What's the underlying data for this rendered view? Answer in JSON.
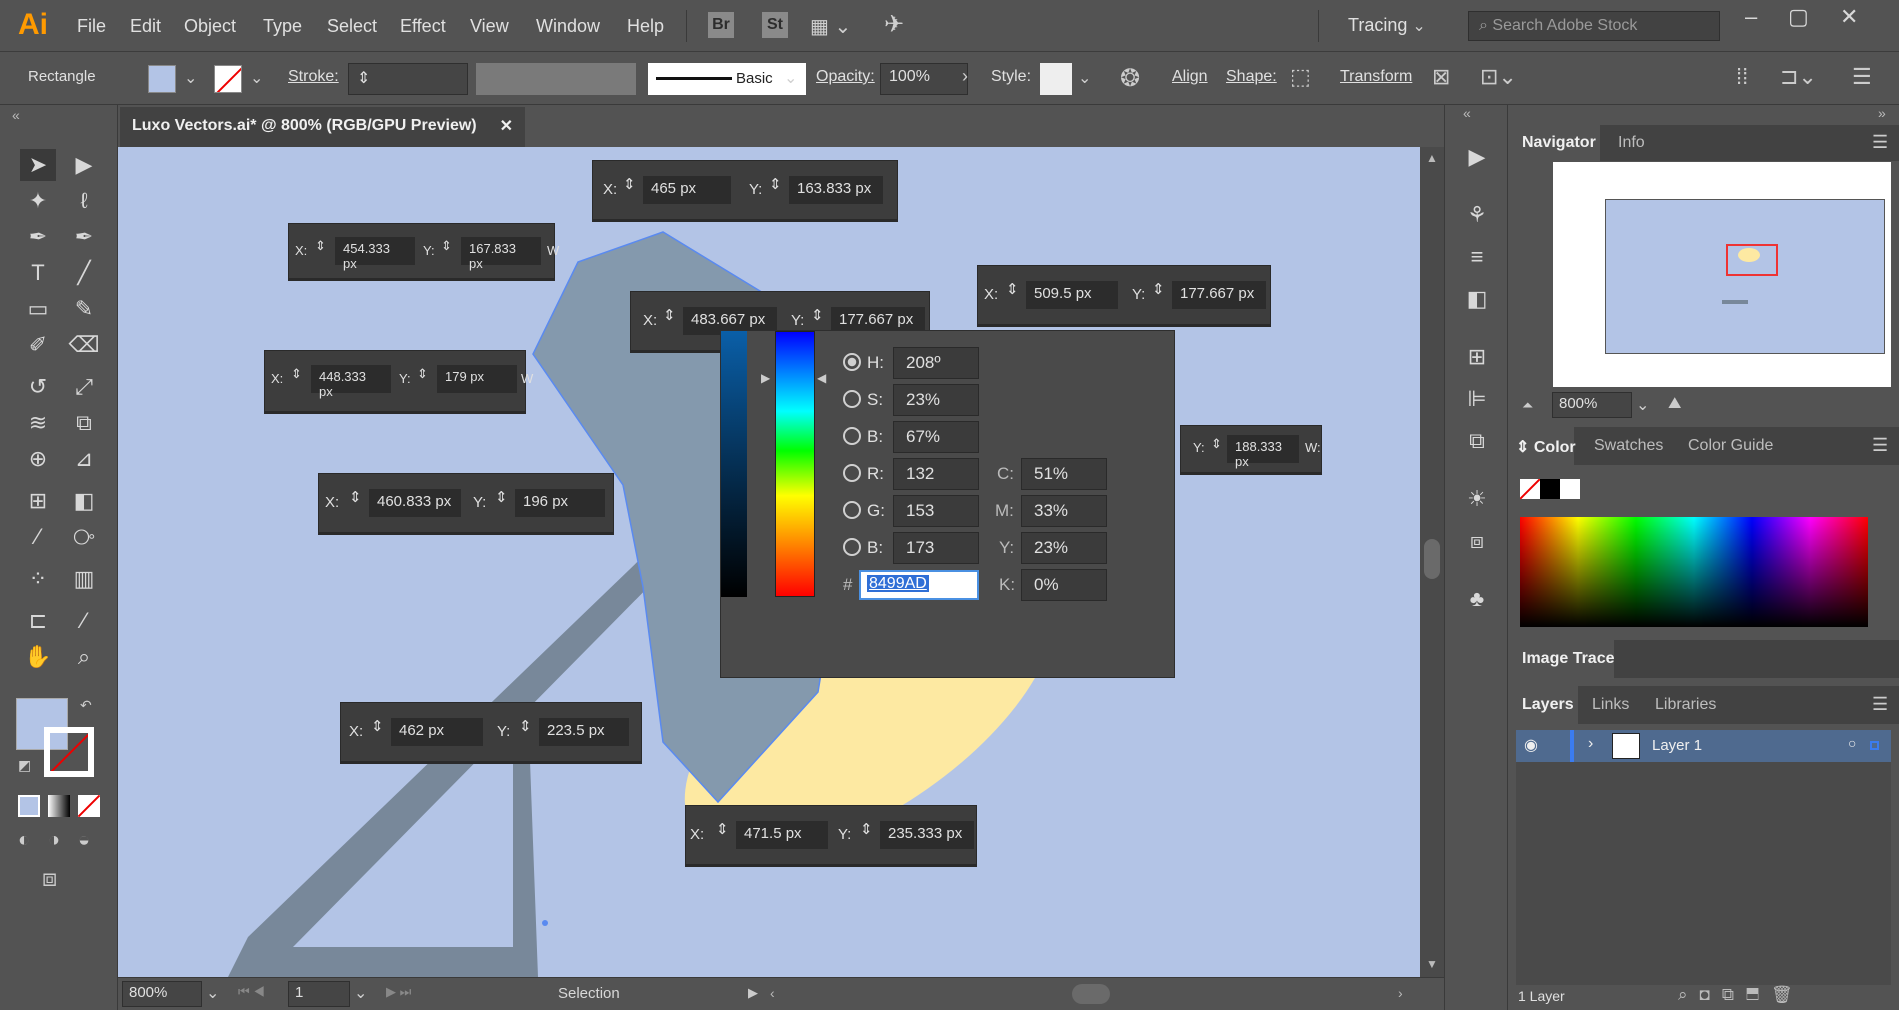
{
  "menubar": {
    "logo": "Ai",
    "items": [
      "File",
      "Edit",
      "Object",
      "Type",
      "Select",
      "Effect",
      "View",
      "Window",
      "Help"
    ],
    "app_br": "Br",
    "app_st": "St",
    "workspace": "Tracing",
    "search_placeholder": "Search Adobe Stock"
  },
  "control": {
    "tool_name": "Rectangle",
    "stroke_label": "Stroke:",
    "brush": "Basic",
    "opacity_label": "Opacity:",
    "opacity_value": "100%",
    "style_label": "Style:",
    "align": "Align",
    "shape": "Shape:",
    "transform": "Transform"
  },
  "document": {
    "tab_title": "Luxo Vectors.ai* @ 800% (RGB/GPU Preview)"
  },
  "coords": [
    {
      "x": "465 px",
      "y": "163.833 px"
    },
    {
      "x": "454.333 px",
      "y": "167.833 px",
      "w": "W"
    },
    {
      "x": "483.667 px",
      "y": "177.667 px"
    },
    {
      "x": "509.5 px",
      "y": "177.667 px"
    },
    {
      "x": "448.333 px",
      "y": "179 px",
      "w": "W"
    },
    {
      "y": "188.333 px",
      "w": "W:"
    },
    {
      "x": "460.833 px",
      "y": "196 px"
    },
    {
      "x": "462 px",
      "y": "223.5 px"
    },
    {
      "x": "471.5 px",
      "y": "235.333 px"
    }
  ],
  "labels": {
    "x": "X:",
    "y": "Y:"
  },
  "picker": {
    "h_label": "H:",
    "h": "208º",
    "s_label": "S:",
    "s": "23%",
    "b_label": "B:",
    "b": "67%",
    "r_label": "R:",
    "r": "132",
    "g_label": "G:",
    "g": "153",
    "bl_label": "B:",
    "bl": "173",
    "c_label": "C:",
    "c": "51%",
    "m_label": "M:",
    "m": "33%",
    "y_label": "Y:",
    "y": "23%",
    "k_label": "K:",
    "k": "0%",
    "hash": "#",
    "hex": "8499AD"
  },
  "status": {
    "zoom": "800%",
    "artboard": "1",
    "mode": "Selection"
  },
  "navigator": {
    "tabs": [
      "Navigator",
      "Info"
    ],
    "zoom": "800%"
  },
  "color_panel": {
    "tabs": [
      "Color",
      "Swatches",
      "Color Guide"
    ]
  },
  "image_trace": "Image Trace",
  "layers": {
    "tabs": [
      "Layers",
      "Links",
      "Libraries"
    ],
    "layer_name": "Layer 1",
    "count": "1 Layer"
  },
  "colors": {
    "canvas": "#b3c4e6",
    "lamp": "#8499ad",
    "bulb": "#fde9a2",
    "ui": "#535353"
  }
}
